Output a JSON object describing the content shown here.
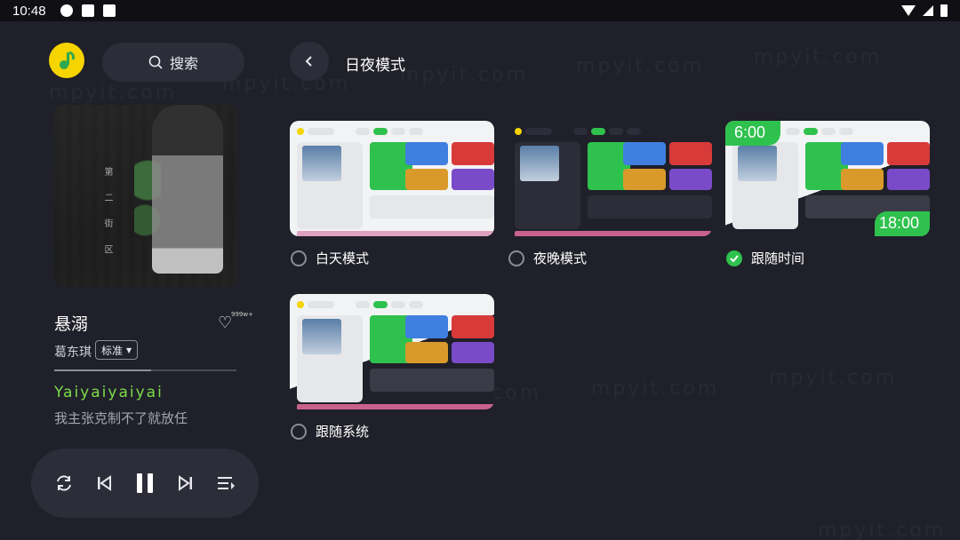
{
  "status_bar": {
    "time": "10:48"
  },
  "search": {
    "label": "搜索"
  },
  "now_playing": {
    "title": "悬溺",
    "artist": "葛东琪",
    "quality": "标准",
    "like_count": "999w+",
    "progress": 0.53,
    "lyric_current": "Yaiyaiyaiyai",
    "lyric_next": "我主张克制不了就放任",
    "album_text": "第 二 街 区"
  },
  "page": {
    "title": "日夜模式"
  },
  "themes": [
    {
      "label": "白天模式",
      "selected": false
    },
    {
      "label": "夜晚模式",
      "selected": false
    },
    {
      "label": "跟随时间",
      "selected": true,
      "badge_day": "6:00",
      "badge_night": "18:00"
    },
    {
      "label": "跟随系统",
      "selected": false
    }
  ],
  "colors": {
    "background": "#1f2029",
    "panel": "#2c2d38",
    "accent_green": "#2fc14e",
    "lyric_green": "#7ddc4a",
    "logo_yellow": "#f5d400"
  },
  "watermark": "mpyit.com"
}
